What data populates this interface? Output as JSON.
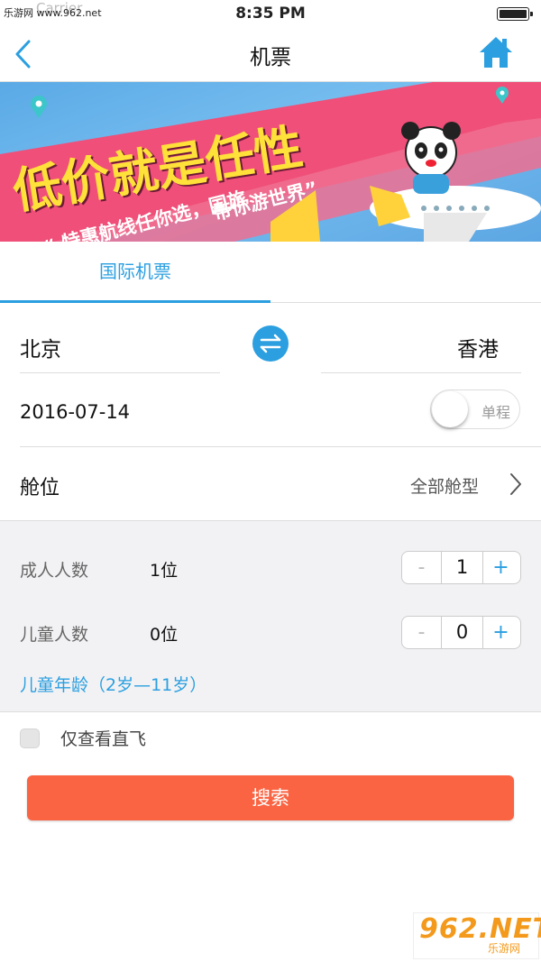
{
  "status_bar": {
    "site_watermark": "乐游网 www.962.net",
    "carrier": "Carrier",
    "time": "8:35 PM"
  },
  "nav": {
    "title": "机票",
    "back_icon": "chevron-left-icon",
    "home_icon": "home-icon"
  },
  "banner": {
    "headline": "低价就是任性",
    "line1": "“ 特惠航线任你选，国旅",
    "line2": "带你游世界”"
  },
  "tabs": [
    {
      "label": "国际机票",
      "active": true
    }
  ],
  "route": {
    "from_city": "北京",
    "to_city": "香港",
    "swap_icon": "swap-arrows-icon"
  },
  "date": {
    "value": "2016-07-14",
    "trip_type_label": "单程"
  },
  "cabin": {
    "label": "舱位",
    "value": "全部舱型"
  },
  "passengers": {
    "adult_label": "成人人数",
    "adult_count": "1位",
    "adult_value": "1",
    "child_label": "儿童人数",
    "child_count": "0位",
    "child_value": "0",
    "minus": "-",
    "plus": "+",
    "child_age_note": "儿童年龄（2岁—11岁）"
  },
  "direct_only": {
    "label": "仅查看直飞",
    "checked": false
  },
  "search_button": "搜索",
  "footer_watermark": {
    "brand": "962.NET",
    "sub": "乐游网"
  },
  "colors": {
    "accent_blue": "#2b9fe0",
    "search_orange": "#fa6442",
    "section_gray": "#f2f2f4"
  }
}
